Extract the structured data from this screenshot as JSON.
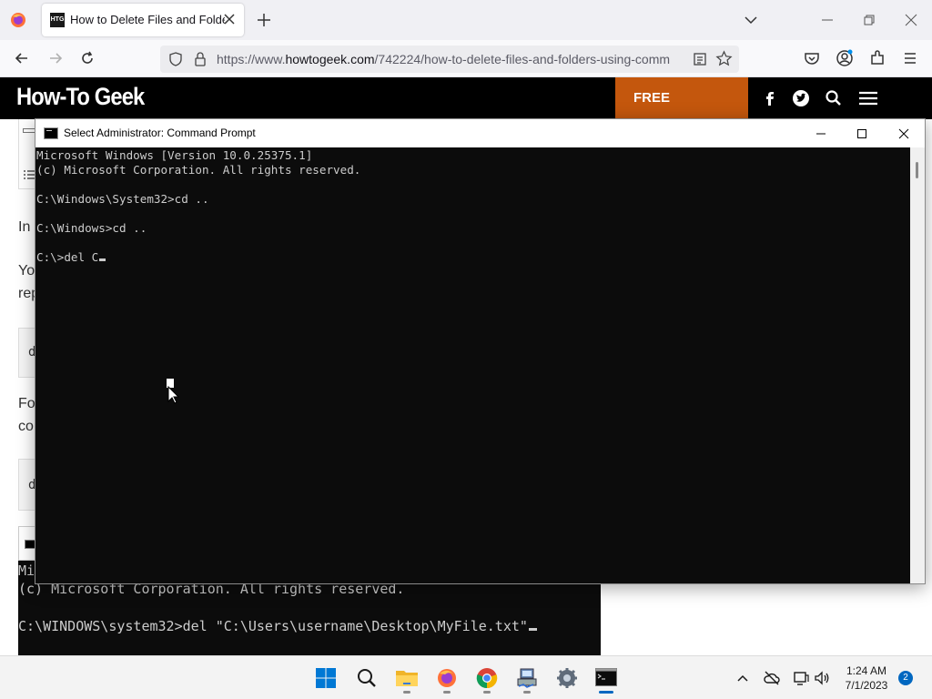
{
  "browser": {
    "tab": {
      "title": "How to Delete Files and Folders Using Command Prompt",
      "favicon_text": "HTG"
    },
    "url": {
      "prefix": "https://www.",
      "domain": "howtogeek.com",
      "path": "/742224/how-to-delete-files-and-folders-using-comm"
    }
  },
  "site": {
    "logo": "How-To Geek",
    "free_label": "FREE",
    "accent_color": "#c4570d"
  },
  "article": {
    "frag_in": "In",
    "frag_yo": "Yo",
    "frag_rep": "rep",
    "frag_d1": "d",
    "frag_fo": "Fo",
    "frag_co": "co",
    "frag_d2": "d",
    "frag_mi": "Mi",
    "terminal": {
      "line1": "(c) Microsoft Corporation. All rights reserved.",
      "line2": "C:\\WINDOWS\\system32>del \"C:\\Users\\username\\Desktop\\MyFile.txt\""
    }
  },
  "cmd": {
    "title": "Select Administrator: Command Prompt",
    "lines": [
      "Microsoft Windows [Version 10.0.25375.1]",
      "(c) Microsoft Corporation. All rights reserved.",
      "C:\\Windows\\System32>cd ..",
      "C:\\Windows>cd ..",
      "C:\\>del C"
    ]
  },
  "taskbar": {
    "apps": [
      "start-icon",
      "search-icon",
      "file-explorer-icon",
      "firefox-icon",
      "chrome-icon",
      "network-app-icon",
      "settings-icon",
      "command-prompt-icon"
    ],
    "time": "1:24 AM",
    "date": "7/1/2023",
    "notification_count": "2"
  }
}
